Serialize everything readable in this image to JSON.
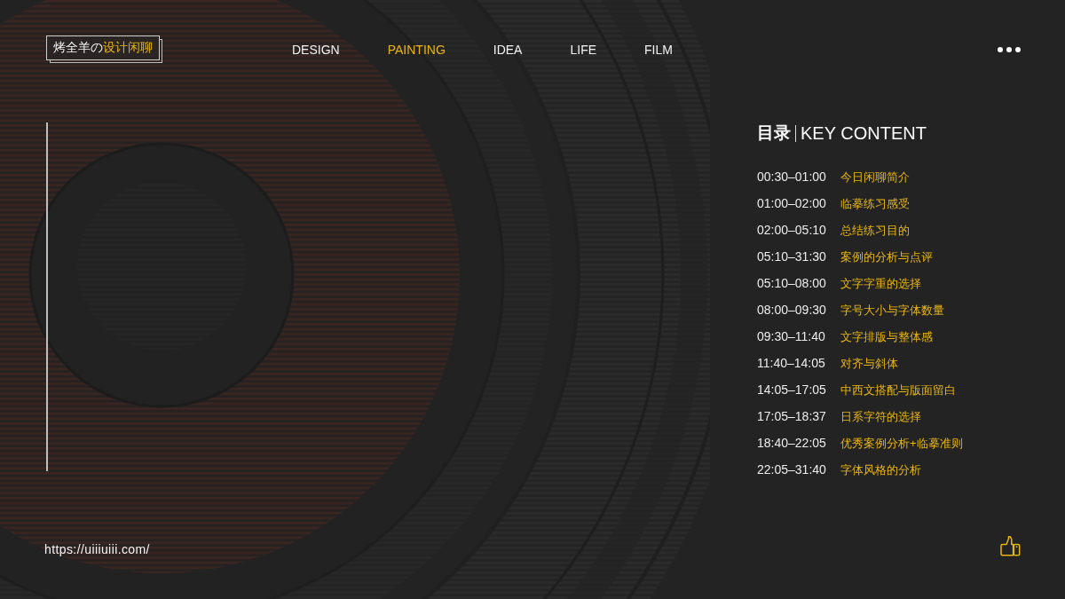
{
  "logo": {
    "prefix": "烤全羊の",
    "highlight": "设计闲聊"
  },
  "nav": [
    {
      "label": "DESIGN",
      "selected": false
    },
    {
      "label": "PAINTING",
      "selected": true
    },
    {
      "label": "IDEA",
      "selected": false
    },
    {
      "label": "LIFE",
      "selected": false
    },
    {
      "label": "FILM",
      "selected": false
    }
  ],
  "contents": {
    "title": "目录",
    "subtitle": "KEY CONTENT",
    "items": [
      {
        "time": "00:30–01:00",
        "topic": "今日闲聊简介"
      },
      {
        "time": "01:00–02:00",
        "topic": "临摹练习感受"
      },
      {
        "time": "02:00–05:10",
        "topic": "总结练习目的"
      },
      {
        "time": "05:10–31:30",
        "topic": "案例的分析与点评"
      },
      {
        "time": "05:10–08:00",
        "topic": "文字字重的选择"
      },
      {
        "time": "08:00–09:30",
        "topic": "字号大小与字体数量"
      },
      {
        "time": "09:30–11:40",
        "topic": "文字排版与整体感"
      },
      {
        "time": "11:40–14:05",
        "topic": "对齐与斜体"
      },
      {
        "time": "14:05–17:05",
        "topic": "中西文搭配与版面留白"
      },
      {
        "time": "17:05–18:37",
        "topic": "日系字符的选择"
      },
      {
        "time": "18:40–22:05",
        "topic": "优秀案例分析+临摹准则"
      },
      {
        "time": "22:05–31:40",
        "topic": "字体风格的分析"
      }
    ]
  },
  "footer": {
    "url": "https://uiiiuiii.com/"
  }
}
